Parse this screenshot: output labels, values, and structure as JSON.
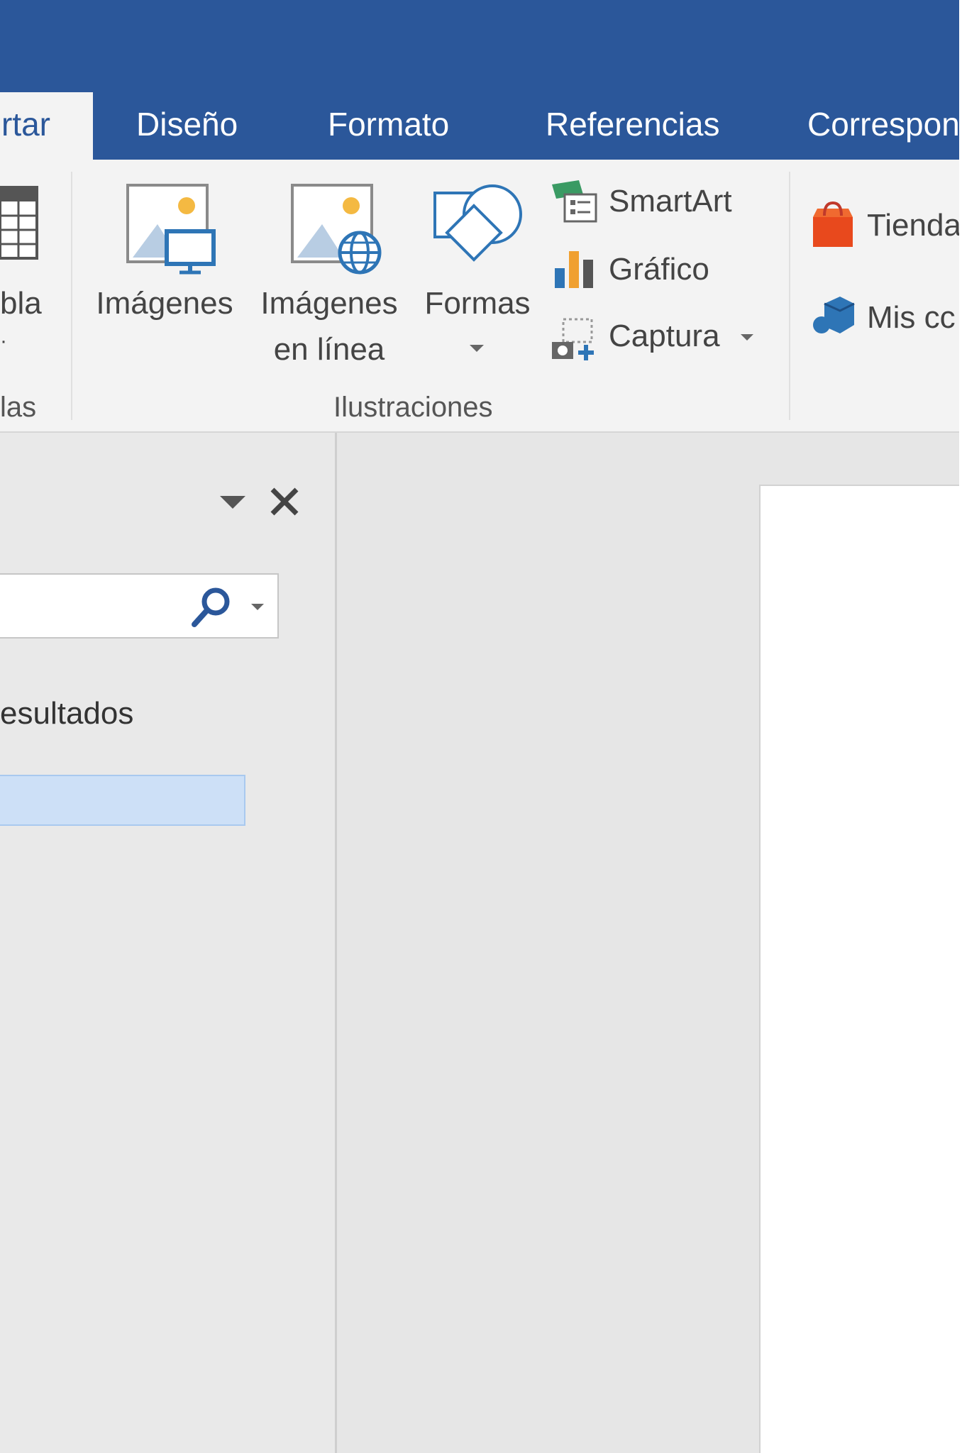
{
  "tabs": [
    {
      "label": "rtar",
      "active": true
    },
    {
      "label": "Diseño",
      "active": false
    },
    {
      "label": "Formato",
      "active": false
    },
    {
      "label": "Referencias",
      "active": false
    },
    {
      "label": "Correspon",
      "active": false
    }
  ],
  "ribbon": {
    "tablas_group": {
      "button_label_line1": "bla",
      "button_label_line2": "·",
      "group_label": "las"
    },
    "ilustraciones": {
      "imagenes": "Imágenes",
      "imagenes_en_linea_line1": "Imágenes",
      "imagenes_en_linea_line2": "en línea",
      "formas": "Formas",
      "smartart": "SmartArt",
      "grafico": "Gráfico",
      "captura": "Captura",
      "group_label": "Ilustraciones"
    },
    "complementos": {
      "tienda": "Tienda",
      "mis_complementos": "Mis cc"
    }
  },
  "task_pane": {
    "search_value": "",
    "results_label": "esultados",
    "highlighted_item": ""
  },
  "colors": {
    "title_bar": "#2b579a",
    "ribbon_bg": "#f3f3f3",
    "workspace_bg": "#e6e6e6",
    "selection": "#cde0f7"
  }
}
